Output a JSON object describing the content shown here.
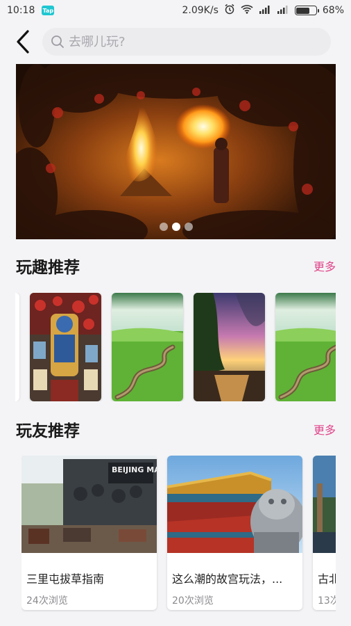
{
  "status_bar": {
    "time": "10:18",
    "app_badge": "Tap",
    "network_speed": "2.09K/s",
    "battery_percent": "68%",
    "battery_level": 0.68
  },
  "header": {
    "search_placeholder": "去哪儿玩?"
  },
  "banner": {
    "slide_count": 3,
    "active_index": 1
  },
  "fun_section": {
    "title": "玩趣推荐",
    "more": "更多"
  },
  "friend_section": {
    "title": "玩友推荐",
    "more": "更多",
    "cards": [
      {
        "title": "三里屯拔草指南",
        "views": "24次浏览",
        "sign": "BEIJING MARKET"
      },
      {
        "title": "这么潮的故宫玩法，...",
        "views": "20次浏览"
      },
      {
        "title": "古北",
        "views": "13次"
      }
    ]
  }
}
